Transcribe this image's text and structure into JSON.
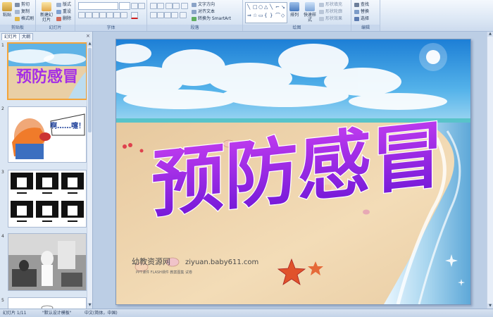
{
  "ribbon": {
    "groups": [
      {
        "label": "剪贴板",
        "buttons": [
          "剪切",
          "复制",
          "格式刷"
        ],
        "big": "粘贴"
      },
      {
        "label": "幻灯片",
        "buttons": [
          "版式",
          "重设",
          "删除"
        ],
        "big": "新建幻灯片"
      },
      {
        "label": "字体"
      },
      {
        "label": "段落",
        "buttons": [
          "文字方向",
          "对齐文本",
          "转换为 SmartArt"
        ]
      },
      {
        "label": "绘图",
        "buttons": [
          "形状填充",
          "形状轮廓",
          "形状效果"
        ],
        "big1": "排列",
        "big2": "快速样式"
      },
      {
        "label": "编辑",
        "buttons": [
          "查找",
          "替换",
          "选择"
        ]
      }
    ]
  },
  "left_panel": {
    "tabs": [
      "幻灯片",
      "大纲"
    ],
    "close": "×",
    "slide_numbers": [
      "1",
      "2",
      "3",
      "4",
      "5"
    ],
    "thumb1_title": "预防感冒",
    "thumb2_text": "啊……嚏！"
  },
  "slide": {
    "title": "预防感冒",
    "watermark": "幼教资源网",
    "watermark_url": "ziyuan.baby611.com",
    "watermark_sub": "PPT课件  FLASH课件  教案图集  试卷",
    "colors": {
      "title_top": "#c33df0",
      "title_bottom": "#6d16d6"
    }
  },
  "status": {
    "slide_info": "幻灯片 1/11",
    "theme": "\"默认设计模板\"",
    "language": "中文(简体，中国)"
  }
}
